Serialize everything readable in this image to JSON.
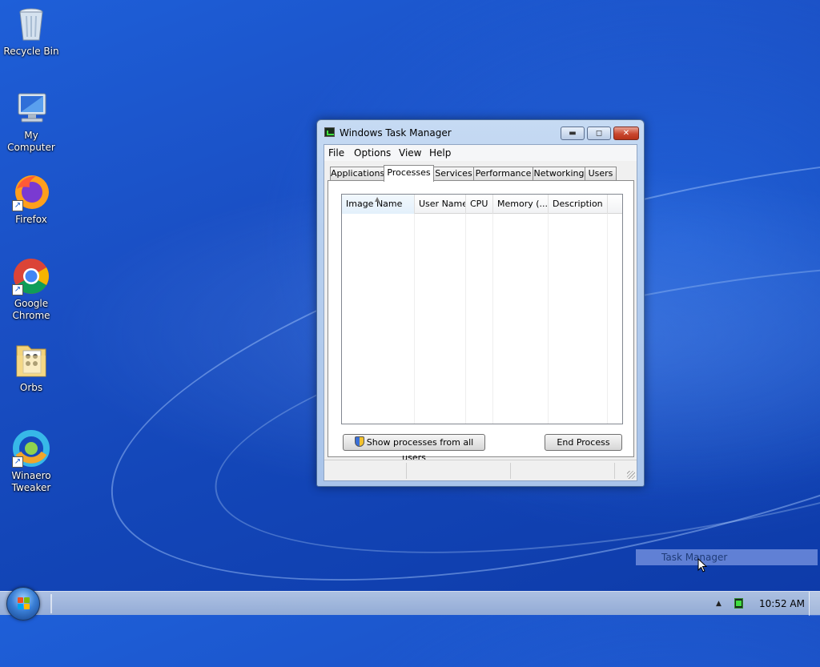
{
  "desktop": {
    "icons": [
      {
        "label": "Recycle Bin",
        "icon": "recycle-bin-icon"
      },
      {
        "label": "My Computer",
        "icon": "computer-icon"
      },
      {
        "label": "Firefox",
        "icon": "firefox-icon"
      },
      {
        "label": "Google Chrome",
        "icon": "chrome-icon"
      },
      {
        "label": "Orbs",
        "icon": "folder-icon"
      },
      {
        "label": "Winaero Tweaker",
        "icon": "winaero-tweaker-icon"
      }
    ]
  },
  "window": {
    "title": "Windows Task Manager",
    "controls": {
      "minimize": "▬",
      "maximize": "◻",
      "close": "✕"
    },
    "menu": [
      "File",
      "Options",
      "View",
      "Help"
    ],
    "tabs": [
      "Applications",
      "Processes",
      "Services",
      "Performance",
      "Networking",
      "Users"
    ],
    "active_tab": "Processes",
    "columns": [
      "Image Name",
      "User Name",
      "CPU",
      "Memory (...",
      "Description"
    ],
    "sorted_column": "Image Name",
    "rows": [],
    "show_all_button": "Show processes from all users",
    "end_process_button": "End Process"
  },
  "taskbar": {
    "clock": "10:52 AM",
    "tray_arrow": "▲",
    "tooltip": "Task Manager"
  },
  "colors": {
    "desktop_blue": "#1a4fc4",
    "window_frame": "#b8d0ef",
    "close_red": "#c9472f"
  }
}
